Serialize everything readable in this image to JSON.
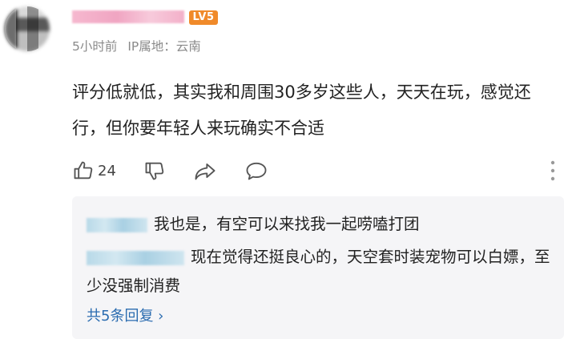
{
  "user": {
    "level_badge": "LV5"
  },
  "meta": {
    "time": "5小时前",
    "ip_location": "IP属地：云南"
  },
  "comment": {
    "text": "评分低就低，其实我和周围30多岁这些人，天天在玩，感觉还行，但你要年轻人来玩确实不合适"
  },
  "actions": {
    "like_count": "24"
  },
  "replies": [
    {
      "text": "我也是，有空可以来找我一起唠嗑打团"
    },
    {
      "text": "现在觉得还挺良心的，天空套时装宠物可以白嫖，至少没强制消费"
    }
  ],
  "view_more": {
    "label": "共5条回复 ›"
  },
  "colors": {
    "level_badge": "#f08a2a",
    "link": "#2b6cb0",
    "meta": "#8a8a8a",
    "reply_bg": "#f5f5f7"
  }
}
